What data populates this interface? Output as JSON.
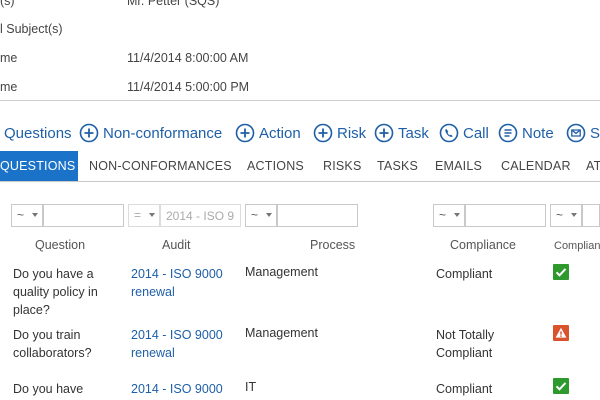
{
  "details": [
    {
      "label": "(s)",
      "value": "Mr. Petter (SQS)"
    },
    {
      "label": "l Subject(s)",
      "value": ""
    },
    {
      "label": "me",
      "value": "11/4/2014 8:00:00 AM"
    },
    {
      "label": "me",
      "value": "11/4/2014 5:00:00 PM"
    }
  ],
  "actions": {
    "questions": "Questions",
    "nonconformance": "Non-conformance",
    "action": "Action",
    "risk": "Risk",
    "task": "Task",
    "call": "Call",
    "note": "Note",
    "email": "Se"
  },
  "tabs": {
    "questions": "QUESTIONS",
    "nonconformances": "NON-CONFORMANCES",
    "actions": "ACTIONS",
    "risks": "RISKS",
    "tasks": "TASKS",
    "emails": "EMAILS",
    "calendar": "CALENDAR",
    "more": "AT"
  },
  "filters": {
    "question_op": "~",
    "audit_op": "=",
    "audit_value": "2014 - ISO 9",
    "process_op": "~",
    "compliance_op": "~",
    "compliance2_op": "~"
  },
  "columns": {
    "question": "Question",
    "audit": "Audit",
    "process": "Process",
    "compliance": "Compliance",
    "compliance2": "Complian"
  },
  "rows": [
    {
      "question": "Do you have a quality policy in place?",
      "audit": "2014 - ISO 9000 renewal",
      "process": "Management",
      "compliance": "Compliant",
      "status": "ok"
    },
    {
      "question": "Do you train collaborators?",
      "audit": "2014 - ISO 9000 renewal",
      "process": "Management",
      "compliance": "Not Totally Compliant",
      "status": "warn"
    },
    {
      "question": "Do you have",
      "audit": "2014 - ISO 9000",
      "process": "IT",
      "compliance": "Compliant",
      "status": "ok"
    }
  ],
  "colors": {
    "accent": "#1a73c9",
    "link": "#1e5fa8",
    "ok": "#2e9a2e",
    "warn": "#d9532c"
  },
  "icons": [
    "plus-circle-icon",
    "phone-icon",
    "note-icon",
    "email-icon",
    "check-icon",
    "warning-icon"
  ]
}
